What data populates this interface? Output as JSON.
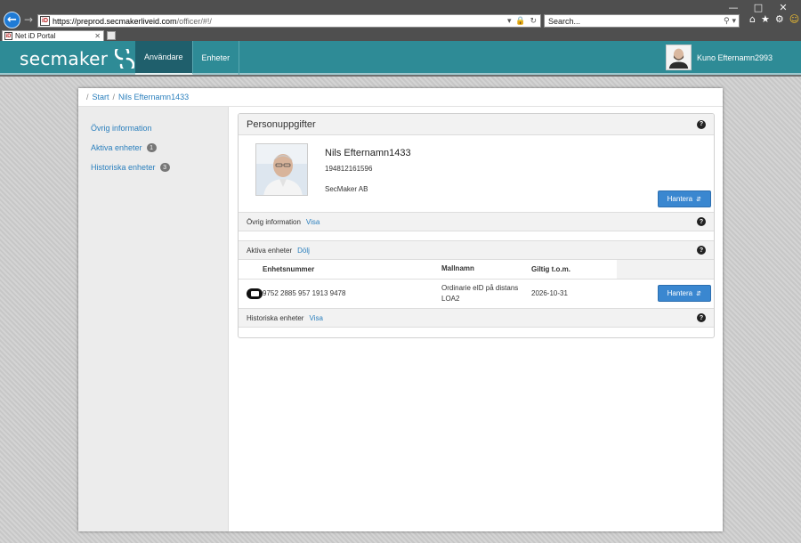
{
  "browser": {
    "url_host": "https://preprod.secmakerliveid.com",
    "url_path": "/officer/#!/",
    "search_placeholder": "Search...",
    "tab_title": "Net iD Portal",
    "favicon_text": "iD"
  },
  "header": {
    "logo_text": "secmaker",
    "nav": [
      {
        "label": "Användare",
        "active": true
      },
      {
        "label": "Enheter",
        "active": false
      }
    ],
    "user_name": "Kuno Efternamn2993"
  },
  "breadcrumb": {
    "items": [
      "Start",
      "Nils Efternamn1433"
    ]
  },
  "sidebar": {
    "items": [
      {
        "label": "Övrig information",
        "badge": null
      },
      {
        "label": "Aktiva enheter",
        "badge": "1"
      },
      {
        "label": "Historiska enheter",
        "badge": "3"
      }
    ]
  },
  "person_panel": {
    "title": "Personuppgifter",
    "name": "Nils Efternamn1433",
    "personal_number": "194812161596",
    "organization": "SecMaker AB",
    "manage_label": "Hantera"
  },
  "other_info": {
    "title": "Övrig information",
    "link": "Visa"
  },
  "active_devices": {
    "title": "Aktiva enheter",
    "link": "Dölj",
    "columns": [
      "Enhetsnummer",
      "Mallnamn",
      "Giltig t.o.m."
    ],
    "rows": [
      {
        "device_number": "9752 2885 957 1913 9478",
        "template_line1": "Ordinarie eID på distans",
        "template_line2": "LOA2",
        "valid_until": "2026-10-31",
        "manage_label": "Hantera"
      }
    ]
  },
  "historic_devices": {
    "title": "Historiska enheter",
    "link": "Visa"
  },
  "icons": {
    "help": "question-circle-icon",
    "device": "smart-card-icon",
    "caret": "sort-caret-icon"
  },
  "colors": {
    "header": "#2e8b96",
    "nav_active": "#1f5f6c",
    "link": "#2a7fbd",
    "button": "#3a87d0"
  }
}
